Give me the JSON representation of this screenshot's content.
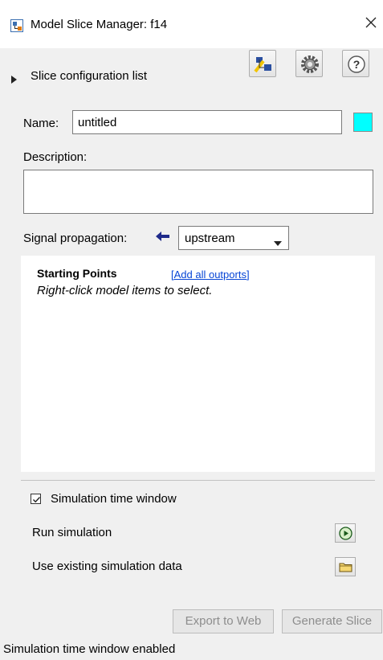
{
  "window": {
    "title": "Model Slice Manager: f14",
    "app_icon": "simulink-icon",
    "close_icon": "close-icon"
  },
  "config_list": {
    "label": "Slice configuration list",
    "expanded": false
  },
  "toolbar": {
    "buttons": [
      "highlight-slice-icon",
      "gear-icon",
      "help-icon"
    ]
  },
  "name": {
    "label": "Name:",
    "value": "untitled",
    "color": "#00FFFF"
  },
  "description": {
    "label": "Description:",
    "value": ""
  },
  "signal_propagation": {
    "label": "Signal propagation:",
    "direction_icon": "arrow-left-icon",
    "value": "upstream"
  },
  "starting_points": {
    "title": "Starting Points",
    "link": "[Add all outports]",
    "hint": "Right-click model items to select."
  },
  "sim_window": {
    "checkbox_label": "Simulation time window",
    "checked": true
  },
  "run_simulation": {
    "label": "Run simulation",
    "icon": "play-icon"
  },
  "existing_data": {
    "label": "Use existing simulation data",
    "icon": "folder-icon"
  },
  "buttons": {
    "export": "Export to Web",
    "generate": "Generate Slice"
  },
  "status": "Simulation time window enabled"
}
